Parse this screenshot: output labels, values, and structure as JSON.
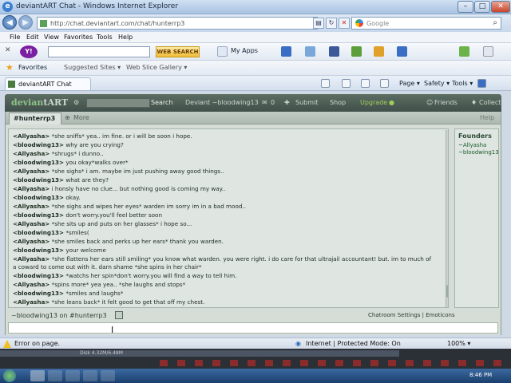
{
  "window": {
    "title": "deviantART Chat - Windows Internet Explorer"
  },
  "address": {
    "url": "http://chat.deviantart.com/chat/hunterrp3",
    "search_placeholder": "Google"
  },
  "menu": [
    "File",
    "Edit",
    "View",
    "Favorites",
    "Tools",
    "Help"
  ],
  "yahoo_toolbar": {
    "logo": "Y!",
    "search_button": "WEB SEARCH",
    "my_apps": "My Apps"
  },
  "favorites_bar": {
    "favorites": "Favorites",
    "suggested": "Suggested Sites ▾",
    "slice": "Web Slice Gallery ▾"
  },
  "tab": {
    "label": "deviantART Chat"
  },
  "command_bar": {
    "page": "Page ▾",
    "safety": "Safety ▾",
    "tools": "Tools ▾"
  },
  "da_bar": {
    "logo_a": "devian",
    "logo_b": "tART",
    "search_button": "Search",
    "user": "Deviant ~bloodwing13",
    "count": "0",
    "submit": "Submit",
    "shop": "Shop",
    "upgrade": "Upgrade",
    "friends": "Friends",
    "collect": "Collect"
  },
  "room": {
    "tab": "#hunterrp3",
    "more": "More",
    "help": "Help",
    "status": "~bloodwing13 on #hunterrp3",
    "settings": "Chatroom Settings | Emoticons"
  },
  "userlist": {
    "header": "Founders",
    "users": [
      "~Allyasha",
      "~bloodwing13"
    ]
  },
  "messages": [
    {
      "nick": "<Allyasha>",
      "text": "*she sniffs* yea.. im fine. or i will be soon i hope."
    },
    {
      "nick": "<bloodwing13>",
      "text": "why are you crying?"
    },
    {
      "nick": "<Allyasha>",
      "text": "*shrugs* i dunno.."
    },
    {
      "nick": "<bloodwing13>",
      "text": "you okay*walks over*"
    },
    {
      "nick": "<Allyasha>",
      "text": "*she sighs* i am. maybe im just pushing away good things.."
    },
    {
      "nick": "<bloodwing13>",
      "text": "what are they?"
    },
    {
      "nick": "<Allyasha>",
      "text": "i honsly have no clue... but nothing good is coming my way.."
    },
    {
      "nick": "<bloodwing13>",
      "text": "okay."
    },
    {
      "nick": "<Allyasha>",
      "text": "*she sighs and wipes her eyes* warden im sorry im in a bad mood.."
    },
    {
      "nick": "<bloodwing13>",
      "text": "don't worry.you'll feel better soon"
    },
    {
      "nick": "<Allyasha>",
      "text": "*she sits up and puts on her glasses* i hope so..."
    },
    {
      "nick": "<bloodwing13>",
      "text": "*smiles("
    },
    {
      "nick": "<Allyasha>",
      "text": "*she smiles back and perks up her ears* thank you warden."
    },
    {
      "nick": "<bloodwing13>",
      "text": "your welcome"
    },
    {
      "nick": "<Allyasha>",
      "text": "*she flattens her ears still smiling* you know what warden. you were right. i do care for that ultrajail accountant! but. im to much of a coward to come out with it. darn shame *she spins in her chair*"
    },
    {
      "nick": "<bloodwing13>",
      "text": "*watchs her spin*don't worry.you will find a way to tell him."
    },
    {
      "nick": "<Allyasha>",
      "text": "*spins more* yea yea.. *she laughs and stops*"
    },
    {
      "nick": "<bloodwing13>",
      "text": "*smiles and laughs*"
    },
    {
      "nick": "<Allyasha>",
      "text": "*she leans back* it felt good to get that off my chest."
    }
  ],
  "ie_status": {
    "left": "Error on page.",
    "zone": "Internet | Protected Mode: On",
    "zoom": "100% ▾"
  },
  "lower_strip": {
    "text": "Disk 4.32M/6.48M"
  },
  "taskbar": {
    "clock": "8:46 PM"
  }
}
